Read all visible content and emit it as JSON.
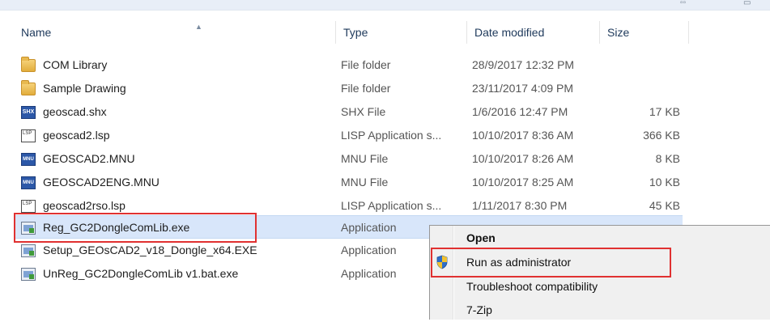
{
  "columns": {
    "name": "Name",
    "type": "Type",
    "date": "Date modified",
    "size": "Size"
  },
  "files": [
    {
      "name": "COM Library",
      "type": "File folder",
      "date": "28/9/2017 12:32 PM",
      "size": "",
      "icon": "folder-icon"
    },
    {
      "name": "Sample Drawing",
      "type": "File folder",
      "date": "23/11/2017 4:09 PM",
      "size": "",
      "icon": "folder-icon"
    },
    {
      "name": "geoscad.shx",
      "type": "SHX File",
      "date": "1/6/2016 12:47 PM",
      "size": "17 KB",
      "icon": "shx-file-icon"
    },
    {
      "name": "geoscad2.lsp",
      "type": "LISP Application s...",
      "date": "10/10/2017 8:36 AM",
      "size": "366 KB",
      "icon": "lsp-file-icon"
    },
    {
      "name": "GEOSCAD2.MNU",
      "type": "MNU File",
      "date": "10/10/2017 8:26 AM",
      "size": "8 KB",
      "icon": "mnu-file-icon"
    },
    {
      "name": "GEOSCAD2ENG.MNU",
      "type": "MNU File",
      "date": "10/10/2017 8:25 AM",
      "size": "10 KB",
      "icon": "mnu-file-icon"
    },
    {
      "name": "geoscad2rso.lsp",
      "type": "LISP Application s...",
      "date": "1/11/2017 8:30 PM",
      "size": "45 KB",
      "icon": "lsp-file-icon"
    },
    {
      "name": "Reg_GC2DongleComLib.exe",
      "type": "Application",
      "date": "",
      "size": "",
      "icon": "application-icon",
      "selected": true
    },
    {
      "name": "Setup_GEOsCAD2_v18_Dongle_x64.EXE",
      "type": "Application",
      "date": "",
      "size": "",
      "icon": "setup-application-icon"
    },
    {
      "name": "UnReg_GC2DongleComLib v1.bat.exe",
      "type": "Application",
      "date": "",
      "size": "",
      "icon": "application-icon"
    }
  ],
  "icon_labels": {
    "shx": "SHX",
    "lsp": "LSP",
    "mnu": "MNU"
  },
  "context_menu": {
    "items": [
      {
        "label": "Open",
        "bold": true
      },
      {
        "label": "Run as administrator",
        "icon": "uac-shield-icon"
      },
      {
        "label": "Troubleshoot compatibility"
      },
      {
        "label": "7-Zip"
      }
    ]
  },
  "highlight_color": "#e03131"
}
